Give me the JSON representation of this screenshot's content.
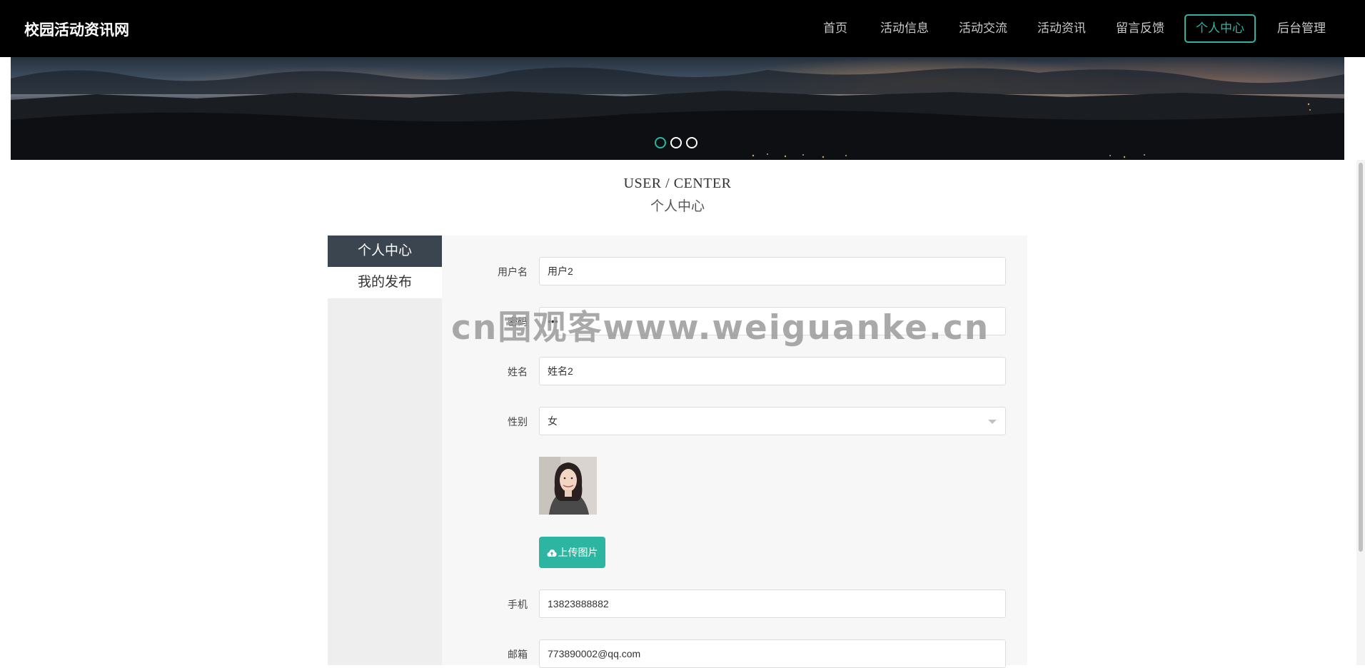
{
  "header": {
    "site_title": "校园活动资讯网",
    "nav": [
      {
        "label": "首页",
        "active": false
      },
      {
        "label": "活动信息",
        "active": false
      },
      {
        "label": "活动交流",
        "active": false
      },
      {
        "label": "活动资讯",
        "active": false
      },
      {
        "label": "留言反馈",
        "active": false
      },
      {
        "label": "个人中心",
        "active": true
      },
      {
        "label": "后台管理",
        "active": false
      }
    ]
  },
  "banner": {
    "slides": 3,
    "active_index": 0
  },
  "section": {
    "title_en": "USER / CENTER",
    "title_cn": "个人中心"
  },
  "sidebar": {
    "items": [
      {
        "label": "个人中心",
        "active": true
      },
      {
        "label": "我的发布",
        "active": false
      }
    ]
  },
  "form": {
    "username_label": "用户名",
    "username_value": "用户2",
    "password_label": "密码",
    "password_value": "•••",
    "name_label": "姓名",
    "name_value": "姓名2",
    "gender_label": "性别",
    "gender_value": "女",
    "upload_label": "上传图片",
    "phone_label": "手机",
    "phone_value": "13823888882",
    "email_label": "邮箱",
    "email_value": "773890002@qq.com"
  },
  "watermark": {
    "text": "cn围观客www.weiguanke.cn"
  },
  "colors": {
    "accent": "#2cb5a1",
    "header_bg": "#000000",
    "sidebar_active_bg": "#3b4550",
    "panel_bg": "#f7f7f7"
  }
}
